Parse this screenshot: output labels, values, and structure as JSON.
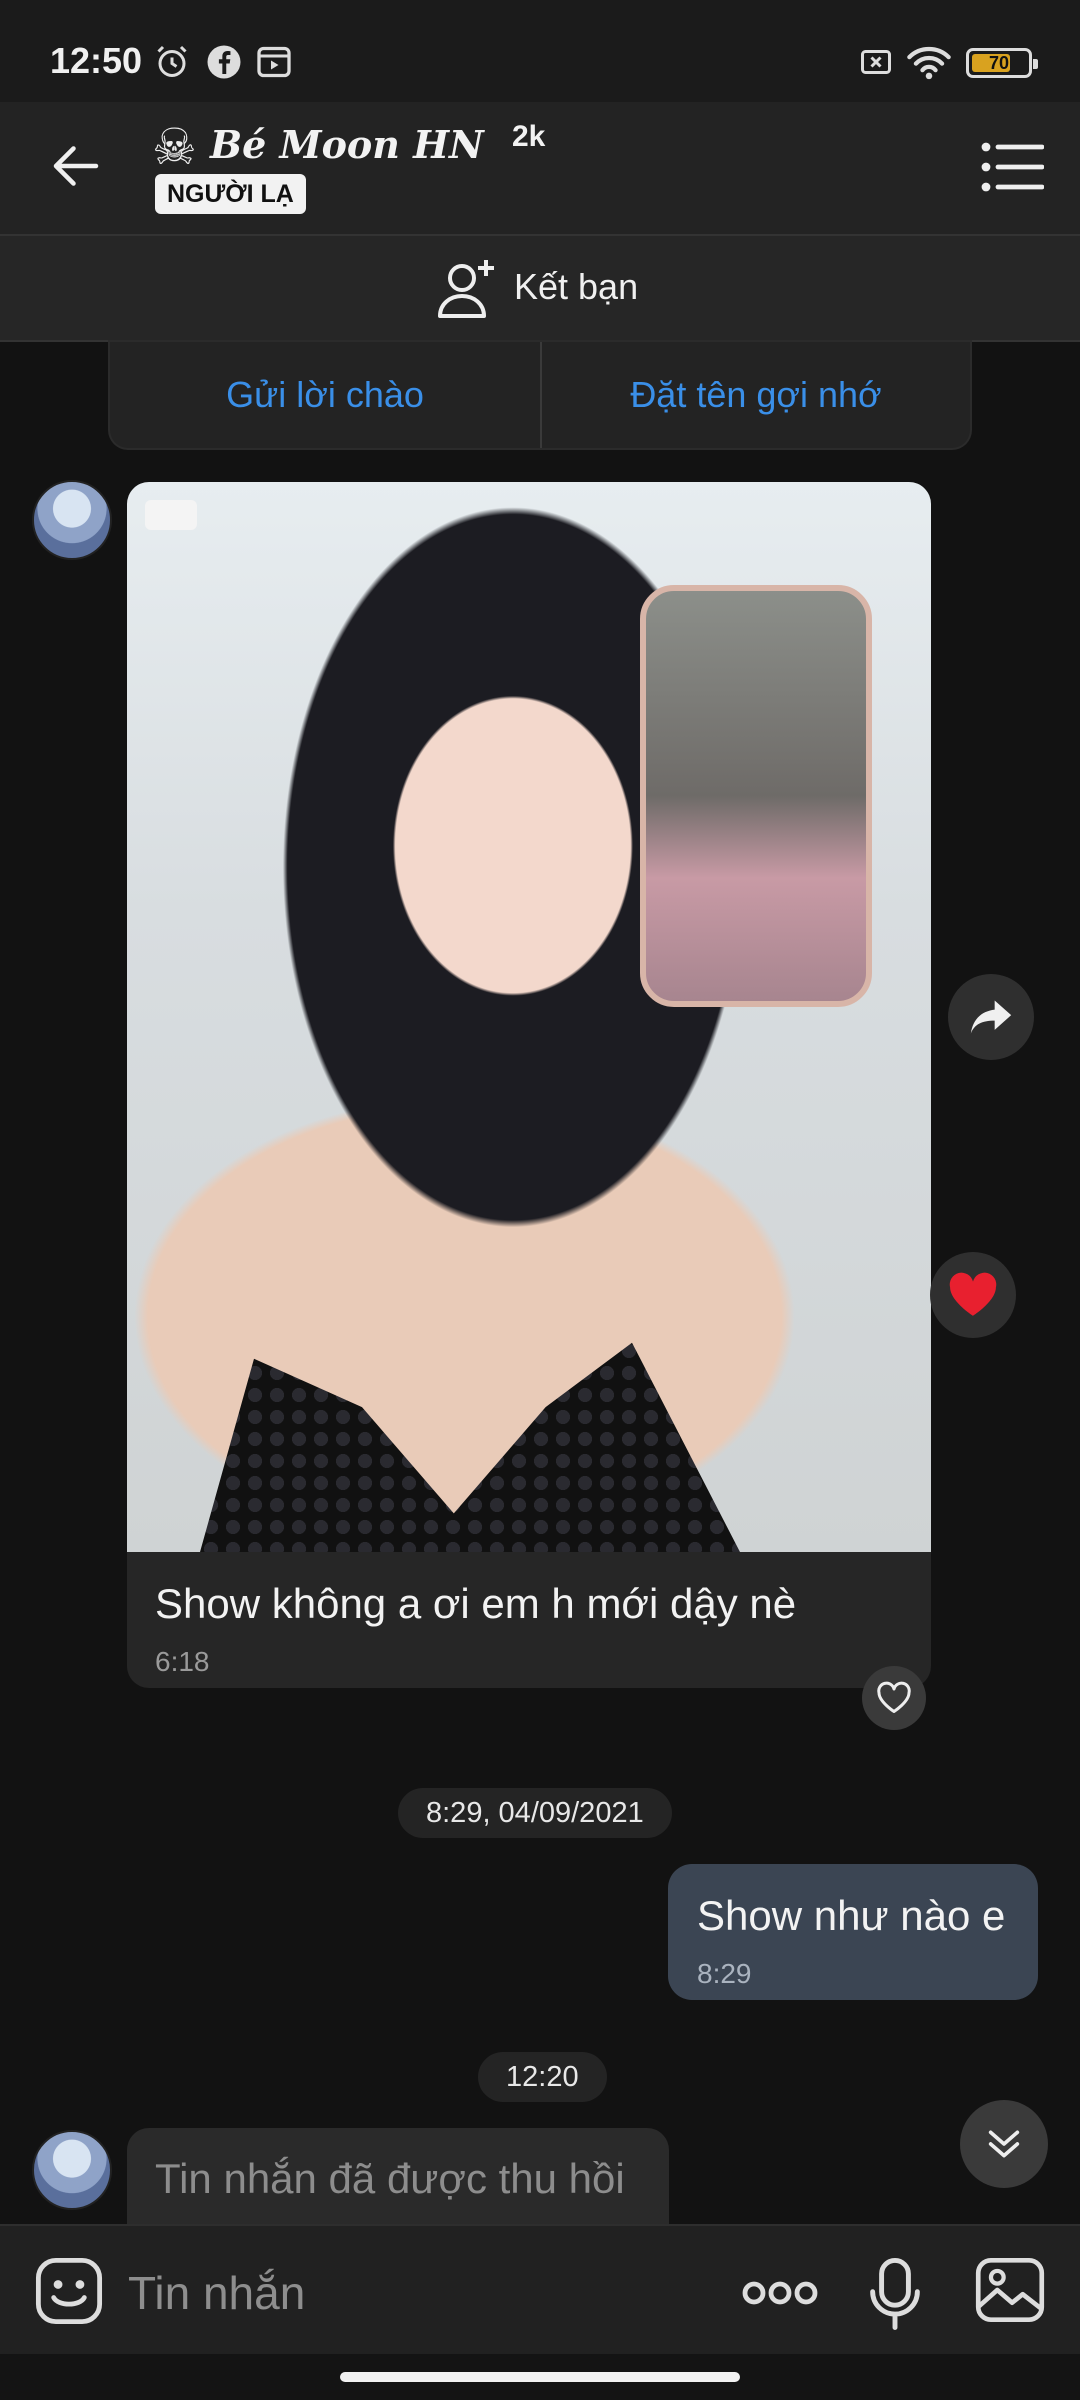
{
  "status_bar": {
    "time": "12:50",
    "battery": "70",
    "icons": [
      "alarm-icon",
      "facebook-icon",
      "screen-record-icon",
      "sim-off-icon",
      "wifi-icon",
      "battery-icon"
    ]
  },
  "header": {
    "title": "Bé Moon HN",
    "title_suffix": "2k",
    "title_icon": "skull-icon",
    "stranger_badge": "NGƯỜI LẠ"
  },
  "add_friend": {
    "label": "Kết bạn"
  },
  "actions": {
    "greet": "Gửi lời chào",
    "nickname": "Đặt tên gợi nhớ"
  },
  "messages": {
    "photo": {
      "caption": "Show không a ơi em h mới dậy nè",
      "time": "6:18"
    },
    "chip_1": "8:29, 04/09/2021",
    "outgoing": {
      "text": "Show như nào e",
      "time": "8:29"
    },
    "chip_2": "12:20",
    "recalled": {
      "text": "Tin nhắn đã được thu hồi"
    }
  },
  "composer": {
    "placeholder": "Tin nhắn"
  },
  "colors": {
    "accent": "#3a8fe8",
    "background": "#121212",
    "outgoing_bubble": "#3b4553",
    "heart": "#e8202f"
  }
}
